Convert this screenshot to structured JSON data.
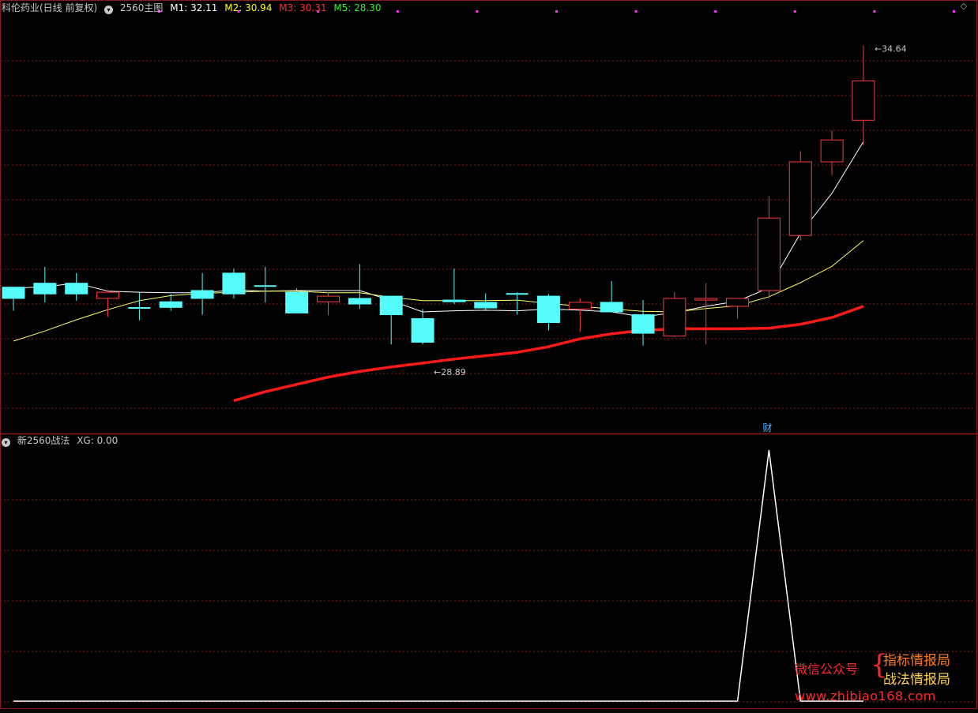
{
  "header": {
    "stock_title": "科伦药业(日线 前复权)",
    "indicator_name": "2560主图",
    "m1": "M1: 32.11",
    "m2": "M2: 30.94",
    "m3": "M3: 30.31",
    "m5": "M5: 28.30",
    "colors": {
      "title": "#c8c8c8",
      "m1": "#ffffff",
      "m2": "#ffff00",
      "m3": "#ff3030",
      "m5": "#33ee33"
    }
  },
  "sub_header": {
    "indicator_name": "新2560战法",
    "xg": "XG: 0.00"
  },
  "icons": {
    "collapse": "chevron-down-icon",
    "settings": "diamond-icon"
  },
  "watermark": {
    "left_text": "微信公众号",
    "right_top": "指标情报局",
    "right_bottom": "战法情报局",
    "url": "www.zhibiao168.com"
  },
  "colors": {
    "up_candle": "#ff3a3a",
    "down_candle": "#54fcfc",
    "doji": "#54fcfc",
    "ma_short": "#ffffff",
    "ma_mid": "#ffff66",
    "ma_long": "#ff1a1a",
    "grid": "#8b1a1a",
    "xg_line": "#ffffff"
  },
  "chart_data": [
    {
      "type": "candlestick",
      "title": "科伦药业(日线 前复权)",
      "ylim": [
        28.2,
        35.0
      ],
      "annotations": [
        {
          "label": "34.64",
          "candle_index": 27,
          "price": 34.64
        },
        {
          "label": "28.89",
          "candle_index": 13,
          "price": 28.89
        },
        {
          "label": "财",
          "candle_index": 24
        }
      ],
      "candles": [
        {
          "o": 30.34,
          "c": 30.14,
          "h": 30.34,
          "l": 29.92
        },
        {
          "o": 30.41,
          "c": 30.22,
          "h": 30.7,
          "l": 30.07
        },
        {
          "o": 30.41,
          "c": 30.22,
          "h": 30.59,
          "l": 30.1
        },
        {
          "o": 30.14,
          "c": 30.25,
          "h": 30.29,
          "l": 29.81
        },
        {
          "o": 29.97,
          "c": 29.95,
          "h": 30.25,
          "l": 29.75
        },
        {
          "o": 30.08,
          "c": 29.98,
          "h": 30.22,
          "l": 29.92
        },
        {
          "o": 30.28,
          "c": 30.14,
          "h": 30.59,
          "l": 29.85
        },
        {
          "o": 30.59,
          "c": 30.22,
          "h": 30.67,
          "l": 30.14
        },
        {
          "o": 30.36,
          "c": 30.34,
          "h": 30.7,
          "l": 30.07
        },
        {
          "o": 30.25,
          "c": 29.88,
          "h": 30.32,
          "l": 29.88
        },
        {
          "o": 30.08,
          "c": 30.18,
          "h": 30.25,
          "l": 29.84
        },
        {
          "o": 30.14,
          "c": 30.04,
          "h": 30.75,
          "l": 29.95
        },
        {
          "o": 30.18,
          "c": 29.85,
          "h": 30.18,
          "l": 29.32
        },
        {
          "o": 29.78,
          "c": 29.36,
          "h": 29.95,
          "l": 29.32
        },
        {
          "o": 30.11,
          "c": 30.08,
          "h": 30.67,
          "l": 30.04
        },
        {
          "o": 30.07,
          "c": 29.97,
          "h": 30.23,
          "l": 29.93
        },
        {
          "o": 30.22,
          "c": 30.21,
          "h": 30.25,
          "l": 29.85
        },
        {
          "o": 30.18,
          "c": 29.71,
          "h": 30.22,
          "l": 29.57
        },
        {
          "o": 29.95,
          "c": 30.07,
          "h": 30.14,
          "l": 29.54
        },
        {
          "o": 30.07,
          "c": 29.9,
          "h": 30.45,
          "l": 29.9
        },
        {
          "o": 29.85,
          "c": 29.52,
          "h": 30.11,
          "l": 29.3
        },
        {
          "o": 29.47,
          "c": 30.14,
          "h": 30.25,
          "l": 29.45
        },
        {
          "o": 30.11,
          "c": 30.14,
          "h": 30.41,
          "l": 29.32
        },
        {
          "o": 30.0,
          "c": 30.14,
          "h": 30.11,
          "l": 29.78
        },
        {
          "o": 30.28,
          "c": 31.57,
          "h": 31.96,
          "l": 30.14
        },
        {
          "o": 31.26,
          "c": 32.57,
          "h": 32.76,
          "l": 31.17
        },
        {
          "o": 32.57,
          "c": 32.96,
          "h": 33.13,
          "l": 32.33
        },
        {
          "o": 33.31,
          "c": 34.01,
          "h": 34.64,
          "l": 32.86
        }
      ],
      "series": [
        {
          "name": "M1",
          "values": [
            30.32,
            30.35,
            30.41,
            30.27,
            30.25,
            30.24,
            30.24,
            30.29,
            30.27,
            30.28,
            30.28,
            30.28,
            30.1,
            29.9,
            29.92,
            29.93,
            29.92,
            29.95,
            29.93,
            29.9,
            29.81,
            29.89,
            30.0,
            30.09,
            30.33,
            31.3,
            32.01,
            32.93
          ]
        },
        {
          "name": "M2",
          "values": [
            29.38,
            29.56,
            29.76,
            29.94,
            30.1,
            30.19,
            30.23,
            30.25,
            30.27,
            30.27,
            30.24,
            30.24,
            30.16,
            30.1,
            30.1,
            30.1,
            30.11,
            30.05,
            30.0,
            29.95,
            29.91,
            29.9,
            29.96,
            30.01,
            30.17,
            30.42,
            30.71,
            31.17
          ]
        },
        {
          "name": "M3",
          "values": [
            null,
            null,
            null,
            null,
            null,
            null,
            null,
            28.32,
            28.48,
            28.61,
            28.74,
            28.84,
            28.92,
            28.99,
            29.06,
            29.12,
            29.18,
            29.28,
            29.42,
            29.51,
            29.57,
            29.6,
            29.6,
            29.6,
            29.61,
            29.68,
            29.8,
            30.0
          ]
        }
      ]
    },
    {
      "type": "line",
      "title": "新2560战法",
      "ylim": [
        0,
        1
      ],
      "series": [
        {
          "name": "XG",
          "values": [
            0,
            0,
            0,
            0,
            0,
            0,
            0,
            0,
            0,
            0,
            0,
            0,
            0,
            0,
            0,
            0,
            0,
            0,
            0,
            0,
            0,
            0,
            0,
            0,
            1,
            0,
            0,
            0
          ]
        }
      ]
    }
  ]
}
